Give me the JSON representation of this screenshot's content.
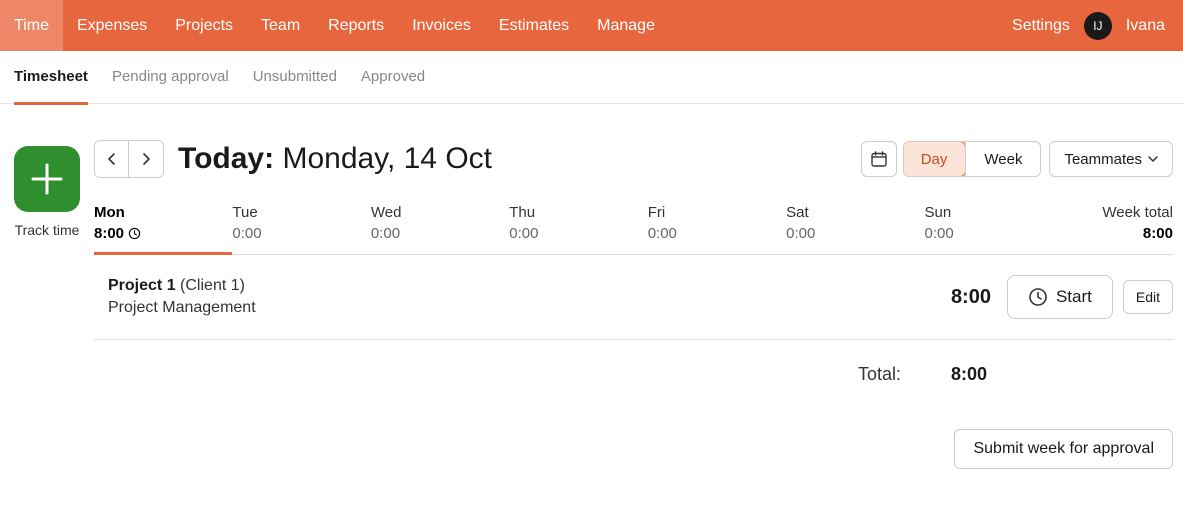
{
  "topnav": {
    "items": [
      "Time",
      "Expenses",
      "Projects",
      "Team",
      "Reports",
      "Invoices",
      "Estimates",
      "Manage"
    ],
    "activeIndex": 0,
    "settings": "Settings",
    "userInitials": "IJ",
    "userName": "Ivana"
  },
  "subtabs": {
    "items": [
      "Timesheet",
      "Pending approval",
      "Unsubmitted",
      "Approved"
    ],
    "activeIndex": 0
  },
  "side": {
    "trackLabel": "Track time"
  },
  "header": {
    "todayLabel": "Today:",
    "dateLabel": "Monday, 14 Oct",
    "viewDay": "Day",
    "viewWeek": "Week",
    "teammates": "Teammates"
  },
  "days": [
    {
      "name": "Mon",
      "time": "8:00",
      "active": true
    },
    {
      "name": "Tue",
      "time": "0:00",
      "active": false
    },
    {
      "name": "Wed",
      "time": "0:00",
      "active": false
    },
    {
      "name": "Thu",
      "time": "0:00",
      "active": false
    },
    {
      "name": "Fri",
      "time": "0:00",
      "active": false
    },
    {
      "name": "Sat",
      "time": "0:00",
      "active": false
    },
    {
      "name": "Sun",
      "time": "0:00",
      "active": false
    }
  ],
  "weekTotal": {
    "label": "Week total",
    "time": "8:00"
  },
  "entry": {
    "project": "Project 1",
    "client": "(Client 1)",
    "task": "Project Management",
    "hours": "8:00",
    "start": "Start",
    "edit": "Edit"
  },
  "total": {
    "label": "Total:",
    "value": "8:00"
  },
  "submit": {
    "label": "Submit week for approval"
  }
}
